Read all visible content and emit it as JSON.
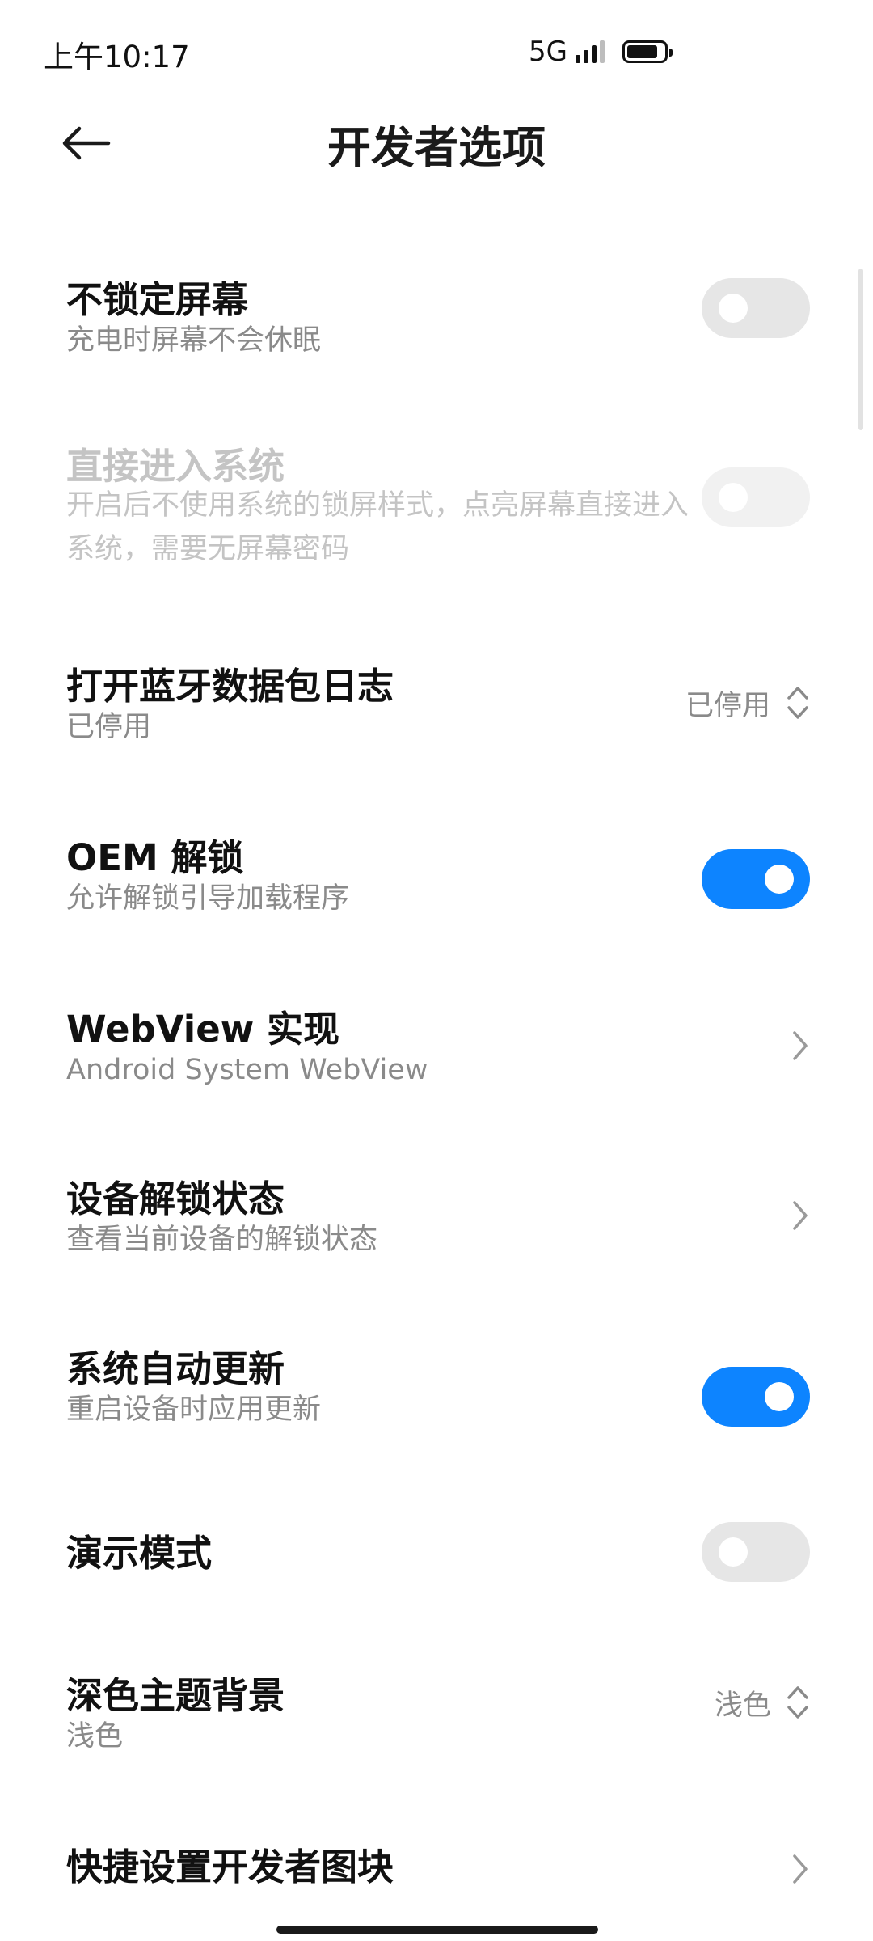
{
  "status_bar": {
    "time": "上午10:17",
    "network": "5G",
    "battery_level": 0.85,
    "signal_icon": "signal-bars-icon"
  },
  "app_bar": {
    "back_icon": "arrow-left-icon",
    "title": "开发者选项"
  },
  "settings": [
    {
      "title": "不锁定屏幕",
      "subtitle": "充电时屏幕不会休眠",
      "control": "toggle",
      "state": "off"
    },
    {
      "title": "直接进入系统",
      "subtitle": "开启后不使用系统的锁屏样式，点亮屏幕直接进入系统，需要无屏幕密码",
      "control": "toggle",
      "state": "disabled"
    },
    {
      "title": "打开蓝牙数据包日志",
      "subtitle": "已停用",
      "control": "select",
      "value": "已停用"
    },
    {
      "title": "OEM 解锁",
      "subtitle": "允许解锁引导加载程序",
      "control": "toggle",
      "state": "on"
    },
    {
      "title": "WebView 实现",
      "subtitle": "Android System WebView",
      "control": "chevron"
    },
    {
      "title": "设备解锁状态",
      "subtitle": "查看当前设备的解锁状态",
      "control": "chevron"
    },
    {
      "title": "系统自动更新",
      "subtitle": "重启设备时应用更新",
      "control": "toggle",
      "state": "on"
    },
    {
      "title": "演示模式",
      "control": "toggle",
      "state": "off"
    },
    {
      "title": "深色主题背景",
      "subtitle": "浅色",
      "control": "select",
      "value": "浅色"
    },
    {
      "title": "快捷设置开发者图块",
      "control": "chevron"
    }
  ],
  "colors": {
    "accent": "#0d84ff",
    "toggle_off": "#e6e6e6",
    "secondary_text": "#8a8a8a",
    "disabled_text": "#c4c4c4"
  }
}
